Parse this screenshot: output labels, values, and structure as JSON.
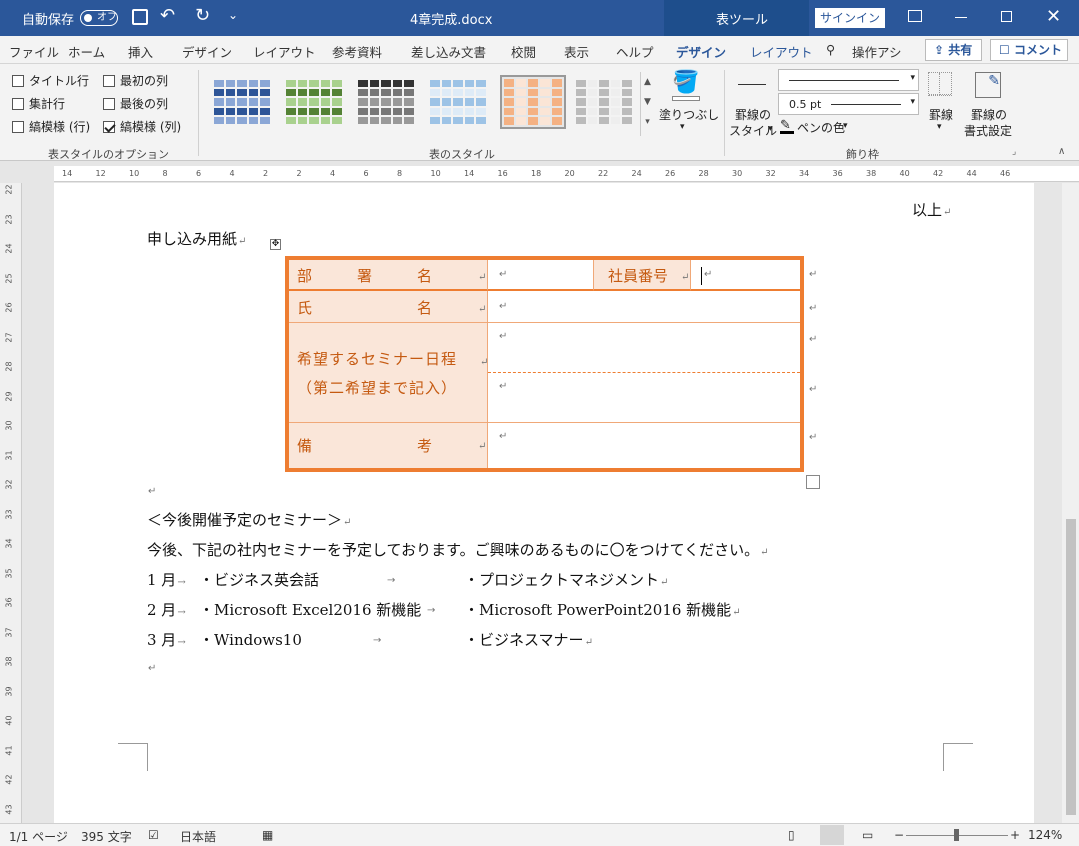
{
  "titlebar": {
    "autosave_label": "自動保存",
    "autosave_state": "オフ",
    "doc_title": "4章完成.docx",
    "context_tab": "表ツール",
    "signin": "サインイン"
  },
  "menu": {
    "tabs": [
      "ファイル",
      "ホーム",
      "挿入",
      "デザイン",
      "レイアウト",
      "参考資料",
      "差し込み文書",
      "校閲",
      "表示",
      "ヘルプ",
      "デザイン",
      "レイアウト"
    ],
    "tell_me": "操作アシ",
    "share": "共有",
    "comment": "コメント"
  },
  "ribbon": {
    "options": {
      "header_row": "タイトル行",
      "first_column": "最初の列",
      "total_row": "集計行",
      "last_column": "最後の列",
      "banded_rows": "縞模様 (行)",
      "banded_columns": "縞模様 (列)",
      "group_label": "表スタイルのオプション"
    },
    "styles_group_label": "表のスタイル",
    "shading_label": "塗りつぶし",
    "border_style_label1": "罫線の",
    "border_style_label2": "スタイル",
    "pen_weight": "0.5 pt",
    "pen_color_label": "ペンの色",
    "borders_label": "罫線",
    "border_painter1": "罫線の",
    "border_painter2": "書式設定",
    "borders_group_label": "飾り枠"
  },
  "ruler": {
    "h_ticks": [
      "14",
      "12",
      "10",
      "8",
      "6",
      "4",
      "2",
      "2",
      "4",
      "6",
      "8",
      "10",
      "14",
      "16",
      "18",
      "20",
      "22",
      "24",
      "26",
      "28",
      "30",
      "32",
      "34",
      "36",
      "38",
      "40",
      "42",
      "44",
      "46"
    ],
    "v_ticks": [
      "22",
      "23",
      "24",
      "25",
      "26",
      "27",
      "28",
      "29",
      "30",
      "31",
      "32",
      "33",
      "34",
      "35",
      "36",
      "37",
      "38",
      "39",
      "40",
      "41",
      "42",
      "43"
    ]
  },
  "document": {
    "closing": "以上",
    "form_title": "申し込み用紙",
    "table": {
      "dept_label": "部　　　署　　　名",
      "emp_no_label": "社員番号",
      "name_label": "氏　　　　　　　名",
      "seminar_label1": "希望するセミナー日程",
      "seminar_label2": "（第二希望まで記入）",
      "remarks_label": "備　　　　　　　考"
    },
    "heading": "＜今後開催予定のセミナー＞",
    "intro": "今後、下記の社内セミナーを予定しております。ご興味のあるものに〇をつけてください。",
    "schedule": [
      {
        "month": "1 月",
        "left": "・ビジネス英会話",
        "right": "・プロジェクトマネジメント"
      },
      {
        "month": "2 月",
        "left": "・Microsoft Excel2016 新機能",
        "right": "・Microsoft PowerPoint2016 新機能"
      },
      {
        "month": "3 月",
        "left": "・Windows10",
        "right": "・ビジネスマナー"
      }
    ]
  },
  "status": {
    "page": "1/1 ページ",
    "words": "395 文字",
    "language": "日本語",
    "zoom": "124%"
  },
  "colors": {
    "title_blue": "#2b579a",
    "table_border": "#ee7d31",
    "header_fill": "#fae6d9",
    "header_text": "#c55a11"
  }
}
